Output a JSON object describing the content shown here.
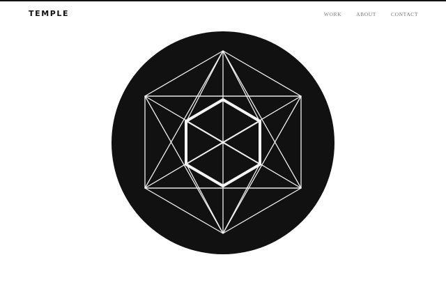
{
  "header": {
    "logo": "TEMPLE",
    "nav": [
      {
        "label": "WORK"
      },
      {
        "label": "ABOUT"
      },
      {
        "label": "CONTACT"
      }
    ]
  },
  "hero": {
    "icon": "sacred-geometry-hexagon-icon",
    "disc_color": "#111111",
    "line_color": "#f2f2f2"
  },
  "colors": {
    "background": "#ffffff",
    "text": "#111111",
    "nav_text": "#777777"
  }
}
